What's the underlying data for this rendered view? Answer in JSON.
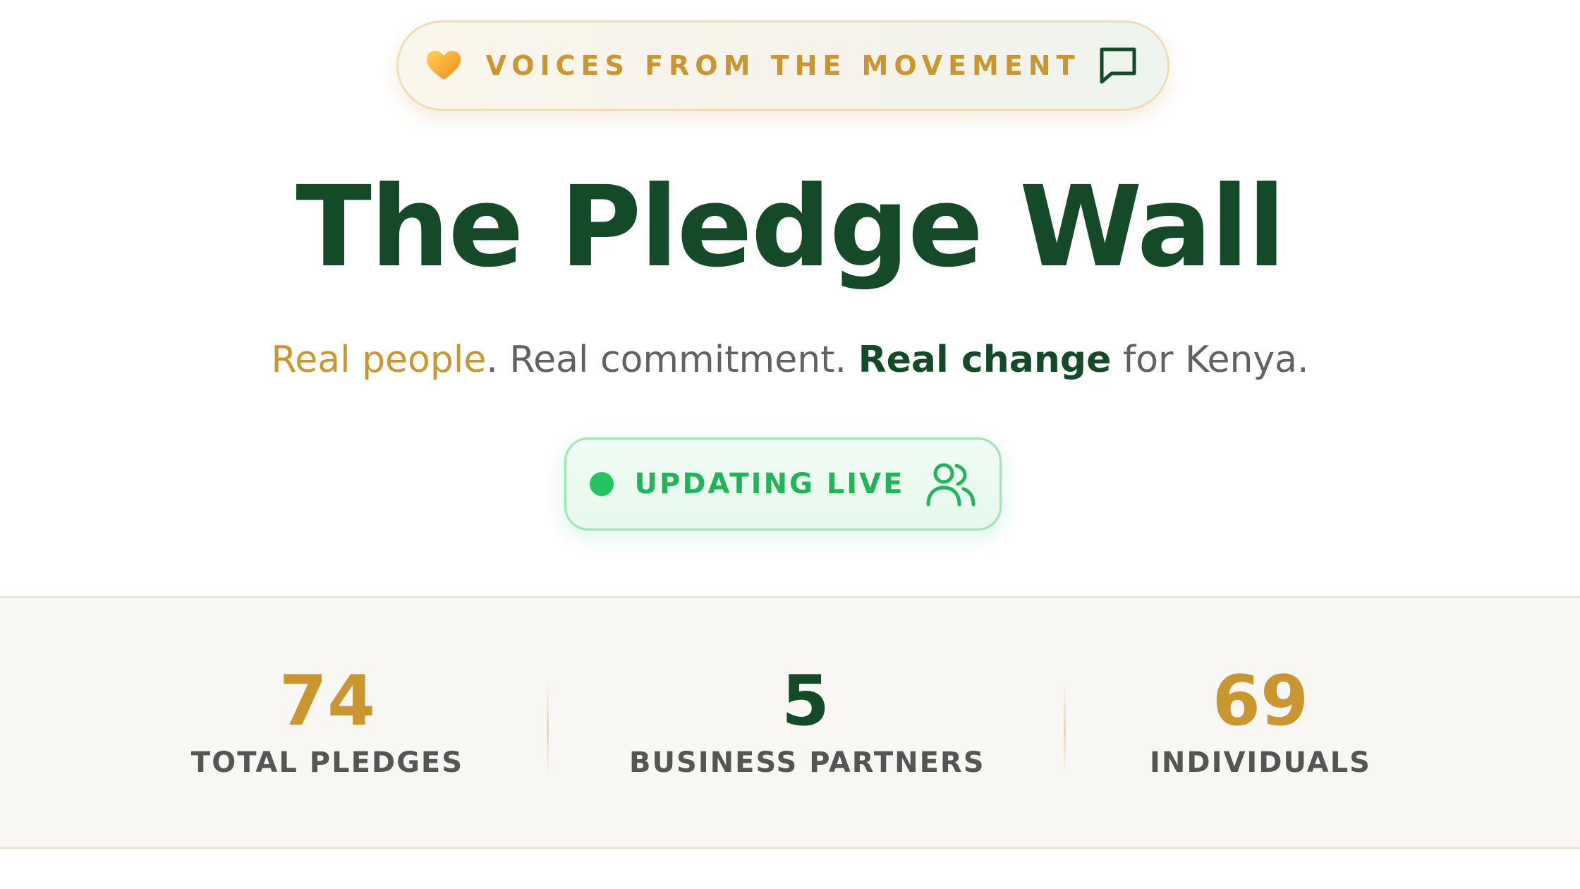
{
  "badge": {
    "text": "VOICES FROM THE MOVEMENT",
    "icon_left": "heart-icon",
    "icon_right": "chat-bubble-icon"
  },
  "header": {
    "title": "The Pledge Wall"
  },
  "subtitle": {
    "part1": "Real people",
    "part2": ". Real commitment. ",
    "part3": "Real change",
    "part4": " for Kenya."
  },
  "live_status": {
    "label": "UPDATING LIVE",
    "icon": "users-icon",
    "dot_color": "#22c55e"
  },
  "stats": [
    {
      "value": "74",
      "label": "TOTAL PLEDGES",
      "color": "#c9962f"
    },
    {
      "value": "5",
      "label": "BUSINESS PARTNERS",
      "color": "#144a28"
    },
    {
      "value": "69",
      "label": "INDIVIDUALS",
      "color": "#c9962f"
    }
  ],
  "colors": {
    "gold": "#c9962f",
    "dark_green": "#144a28",
    "live_green": "#22c55e"
  }
}
